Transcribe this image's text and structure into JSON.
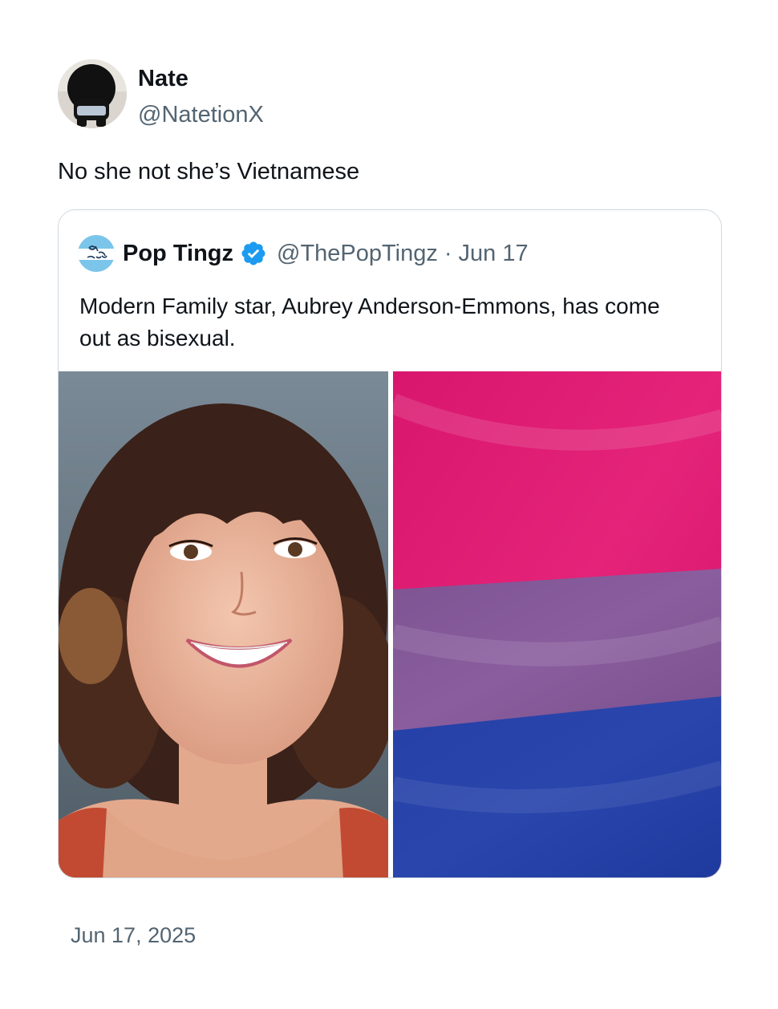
{
  "author": {
    "display_name": "Nate",
    "handle": "@NatetionX",
    "avatar_icon": "profile-avatar"
  },
  "tweet": {
    "text": "No she not she’s Vietnamese",
    "timestamp": "Jun 17, 2025"
  },
  "quoted_tweet": {
    "display_name": "Pop Tingz",
    "verified": true,
    "verified_color": "#1d9bf0",
    "handle": "@ThePopTingz",
    "separator": "·",
    "date": "Jun 17",
    "text": "Modern Family star, Aubrey Anderson-Emmons, has come out as bisexual.",
    "media": [
      {
        "kind": "photo",
        "icon": "portrait-photo"
      },
      {
        "kind": "photo",
        "icon": "bisexual-pride-flag",
        "colors": [
          "#d60270",
          "#9b4f96",
          "#0038a8"
        ]
      }
    ]
  },
  "colors": {
    "text_primary": "#0f1419",
    "text_secondary": "#536471",
    "border": "#cfd9de"
  }
}
